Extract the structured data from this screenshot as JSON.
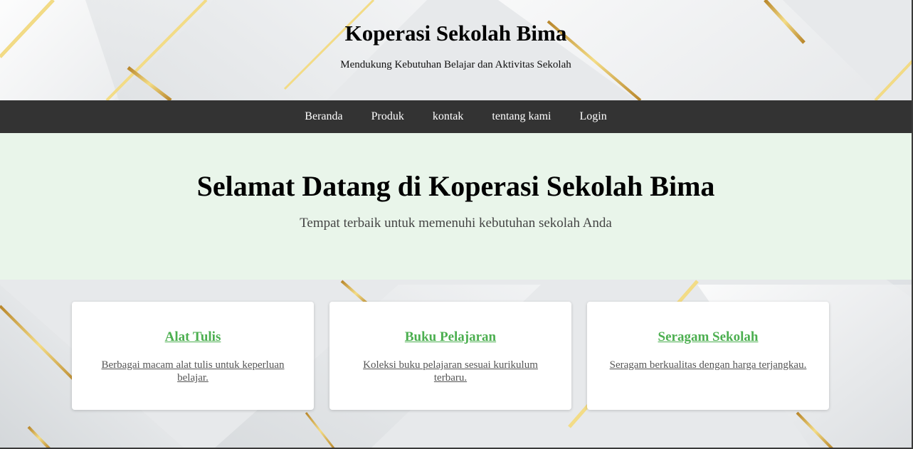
{
  "header": {
    "title": "Koperasi Sekolah Bima",
    "tagline": "Mendukung Kebutuhan Belajar dan Aktivitas Sekolah"
  },
  "nav": {
    "items": [
      {
        "label": "Beranda"
      },
      {
        "label": "Produk"
      },
      {
        "label": "kontak"
      },
      {
        "label": "tentang kami"
      },
      {
        "label": "Login"
      }
    ]
  },
  "hero": {
    "title": "Selamat Datang di Koperasi Sekolah Bima",
    "subtitle": "Tempat terbaik untuk memenuhi kebutuhan sekolah Anda"
  },
  "cards": [
    {
      "title": "Alat Tulis",
      "description": "Berbagai macam alat tulis untuk keperluan belajar."
    },
    {
      "title": "Buku Pelajaran",
      "description": "Koleksi buku pelajaran sesuai kurikulum terbaru."
    },
    {
      "title": "Seragam Sekolah",
      "description": "Seragam berkualitas dengan harga terjangkau."
    }
  ],
  "colors": {
    "nav_background": "#333333",
    "hero_background": "#e9f5ea",
    "card_title": "#4caf50",
    "gold_accent": "#d9b24a"
  }
}
